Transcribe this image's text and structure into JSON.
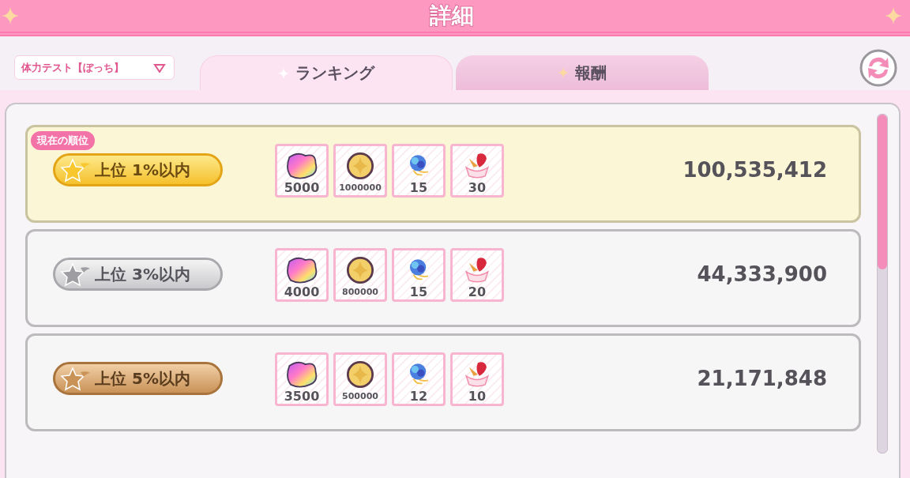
{
  "header": {
    "title": "詳細"
  },
  "dropdown": {
    "value": "体力テスト【ぼっち】"
  },
  "tabs": [
    {
      "label": "ランキング",
      "selected": true
    },
    {
      "label": "報酬",
      "selected": false
    }
  ],
  "rows": [
    {
      "kind": "gold",
      "badge": "現在の順位",
      "rank": "上位 1%以内",
      "score": "100,535,412",
      "rewards": [
        {
          "kind": "gem",
          "count": "5000"
        },
        {
          "kind": "coin",
          "count": "1000000"
        },
        {
          "kind": "rose",
          "count": "15"
        },
        {
          "kind": "cake",
          "count": "30"
        }
      ]
    },
    {
      "kind": "silver",
      "rank": "上位 3%以内",
      "score": "44,333,900",
      "rewards": [
        {
          "kind": "gem",
          "count": "4000"
        },
        {
          "kind": "coin",
          "count": "800000"
        },
        {
          "kind": "rose",
          "count": "15"
        },
        {
          "kind": "cake",
          "count": "20"
        }
      ]
    },
    {
      "kind": "bronze",
      "rank": "上位 5%以内",
      "score": "21,171,848",
      "rewards": [
        {
          "kind": "gem",
          "count": "3500"
        },
        {
          "kind": "coin",
          "count": "500000"
        },
        {
          "kind": "rose",
          "count": "12"
        },
        {
          "kind": "cake",
          "count": "10"
        }
      ]
    }
  ]
}
